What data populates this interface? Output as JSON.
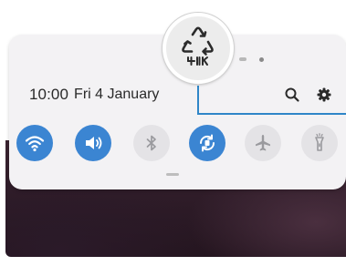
{
  "status_bar": {
    "time": "10:00",
    "date": "Fri 4 January"
  },
  "quick_settings": {
    "toggles": [
      {
        "name": "Wi-Fi",
        "icon": "wifi-icon",
        "state": "on"
      },
      {
        "name": "Sound",
        "icon": "sound-icon",
        "state": "on"
      },
      {
        "name": "Bluetooth",
        "icon": "bluetooth-icon",
        "state": "off"
      },
      {
        "name": "Auto rotate",
        "icon": "auto-rotate-icon",
        "state": "on"
      },
      {
        "name": "Airplane mode",
        "icon": "airplane-icon",
        "state": "off"
      },
      {
        "name": "Flashlight",
        "icon": "flashlight-icon",
        "state": "off"
      }
    ]
  },
  "highlight": {
    "icon": "recycle-icon"
  },
  "colors": {
    "accent": "#3b85d2",
    "callout": "#2f86c8",
    "panel": "#f3f2f4",
    "wallpaper": "#2d1b27"
  }
}
